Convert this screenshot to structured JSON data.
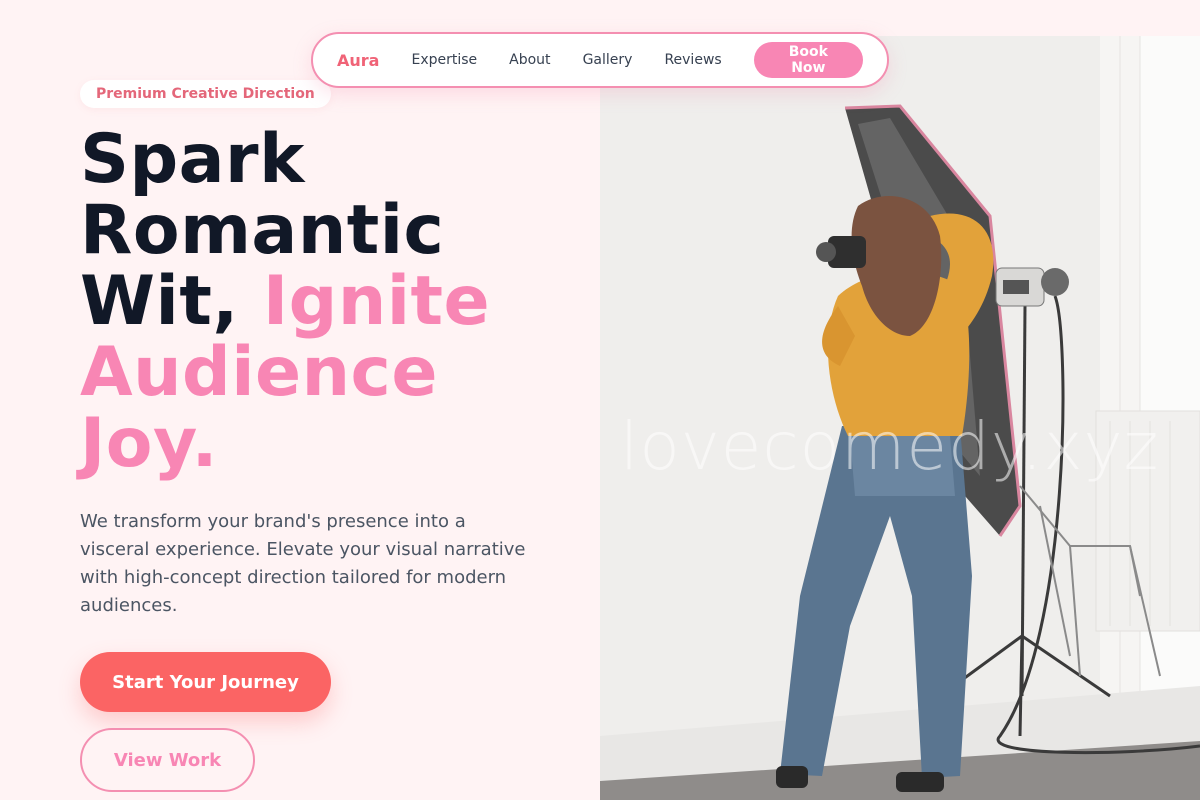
{
  "nav": {
    "brand": "Aura",
    "links": [
      "Expertise",
      "About",
      "Gallery",
      "Reviews"
    ],
    "book_label": "Book Now"
  },
  "hero": {
    "eyebrow": "Premium Creative Direction",
    "headline": {
      "line1": "Spark",
      "line2": "Romantic",
      "line3_start": "Wit,",
      "line3_accent": "Ignite",
      "line4": "Audience",
      "line5": "Joy."
    },
    "description": "We transform your brand's presence into a visceral experience. Elevate your visual narrative with high-concept direction tailored for modern audiences.",
    "primary_cta": "Start Your Journey",
    "secondary_cta": "View Work",
    "image_watermark": "lovecomedy.xyz"
  },
  "colors": {
    "background": "#fff3f4",
    "brand": "#f06377",
    "accent_pink": "#f886b4",
    "cta_coral": "#fb6464",
    "heading": "#111827",
    "body_text": "#4b5563"
  }
}
